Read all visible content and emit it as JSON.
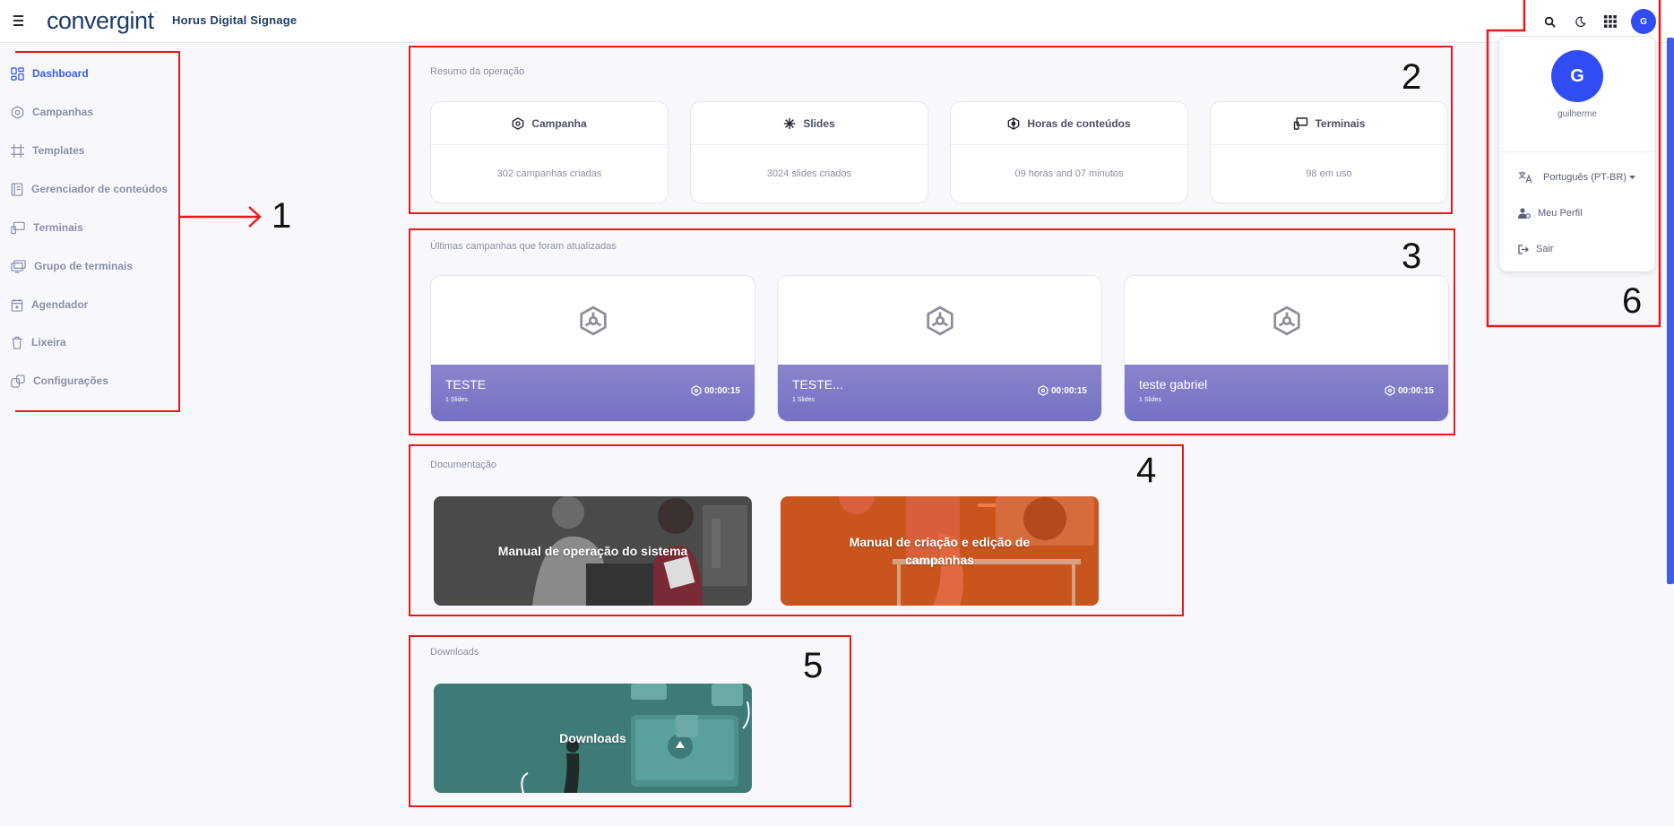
{
  "header": {
    "logo_text": "convergint",
    "logo_mark": "·",
    "app_title": "Horus Digital Signage",
    "icons": [
      "menu-icon",
      "search-icon",
      "moon-icon",
      "apps-grid-icon"
    ],
    "avatar_initial": "G"
  },
  "sidebar": {
    "items": [
      {
        "label": "Dashboard",
        "icon": "dashboard-icon",
        "active": true
      },
      {
        "label": "Campanhas",
        "icon": "campaign-icon"
      },
      {
        "label": "Templates",
        "icon": "crop-icon"
      },
      {
        "label": "Gerenciador de conteúdos",
        "icon": "content-manager-icon"
      },
      {
        "label": "Terminais",
        "icon": "terminal-icon"
      },
      {
        "label": "Grupo de terminais",
        "icon": "terminal-group-icon"
      },
      {
        "label": "Agendador",
        "icon": "calendar-icon"
      },
      {
        "label": "Lixeira",
        "icon": "trash-icon"
      },
      {
        "label": "Configurações",
        "icon": "settings-icon"
      }
    ]
  },
  "summary": {
    "label": "Resumo da operação",
    "cards": [
      {
        "title": "Campanha",
        "value": "302 campanhas criadas",
        "icon": "campaign-icon"
      },
      {
        "title": "Slides",
        "value": "3024 slides criados",
        "icon": "slides-icon"
      },
      {
        "title": "Horas de conteúdos",
        "value": "09 horas and 07 minutos",
        "icon": "hours-icon"
      },
      {
        "title": "Terminais",
        "value": "98 em uso",
        "icon": "terminal-icon"
      }
    ]
  },
  "recent": {
    "label": "Últimas campanhas que foram atualizadas",
    "cards": [
      {
        "name": "TESTE",
        "slides": "1 Slides",
        "duration": "00:00:15"
      },
      {
        "name": "TESTE...",
        "slides": "1 Slides",
        "duration": "00:00:15"
      },
      {
        "name": "teste gabriel",
        "slides": "1 Slides",
        "duration": "00:00:15"
      }
    ]
  },
  "docs": {
    "label": "Documentação",
    "items": [
      {
        "title": "Manual de operação do sistema",
        "color": "#4a4a4a"
      },
      {
        "title": "Manual de criação e edição de campanhas",
        "color": "#c8551e"
      }
    ]
  },
  "downloads": {
    "label": "Downloads",
    "item_title": "Downloads",
    "color": "#3e7a78"
  },
  "profile": {
    "initial": "G",
    "name": "guilherme",
    "language": "Português (PT-BR)",
    "my_profile": "Meu Perfil",
    "logout": "Sair"
  },
  "annotations": [
    "1",
    "2",
    "3",
    "4",
    "5",
    "6"
  ],
  "colors": {
    "accent": "#2f4cf5",
    "campaign_band": "#7e7ac8",
    "annotation": "#e41b1b"
  }
}
